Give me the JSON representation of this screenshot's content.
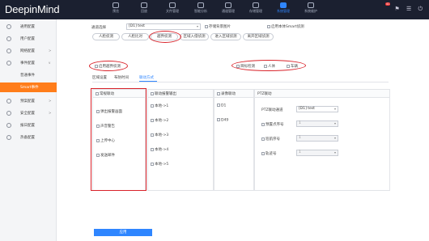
{
  "app": {
    "logo": "DeepinMind"
  },
  "topnav": [
    {
      "label": "预览",
      "icon": "preview-icon"
    },
    {
      "label": "回放",
      "icon": "playback-icon"
    },
    {
      "label": "文件管理",
      "icon": "file-icon"
    },
    {
      "label": "智能分析",
      "icon": "analysis-icon"
    },
    {
      "label": "通道管理",
      "icon": "channel-icon"
    },
    {
      "label": "存储管理",
      "icon": "storage-icon"
    },
    {
      "label": "系统管理",
      "icon": "system-icon"
    },
    {
      "label": "系统维护",
      "icon": "maintenance-icon"
    }
  ],
  "topbar": {
    "badge": "41",
    "active_index": 6
  },
  "sidebar": {
    "items": [
      {
        "label": "通用配置",
        "icon": "settings-icon",
        "arrow": ""
      },
      {
        "label": "用户配置",
        "icon": "user-icon",
        "arrow": ""
      },
      {
        "label": "网络配置",
        "icon": "network-icon",
        "arrow": ">"
      },
      {
        "label": "事件配置",
        "icon": "event-icon",
        "arrow": "v"
      }
    ],
    "sub_items": [
      {
        "label": "普通事件"
      },
      {
        "label": "Smart事件"
      }
    ],
    "more_items": [
      {
        "label": "预案配置",
        "icon": "plan-icon",
        "arrow": ">"
      },
      {
        "label": "安全配置",
        "icon": "security-icon",
        "arrow": ">"
      },
      {
        "label": "报日配置",
        "icon": "log-icon",
        "arrow": ""
      },
      {
        "label": "热备配置",
        "icon": "hotbackup-icon",
        "arrow": ""
      }
    ]
  },
  "form": {
    "channel_label": "通道选择",
    "channel_value": "[D1] test",
    "save_image_label": "存储背景图片",
    "enable_smart_label": "启用本体Smart侦测"
  },
  "tabs": [
    "人脸侦测",
    "人脸比对",
    "越界侦测",
    "区域入侵侦测",
    "进入区域侦测",
    "离开区域侦测"
  ],
  "enable_row": {
    "enable_label": "启用越界侦测",
    "target_label": "目标检测",
    "human_label": "人体",
    "vehicle_label": "车辆"
  },
  "subtabs": [
    "区域设置",
    "布防时间",
    "联动方式"
  ],
  "panels": {
    "regular": {
      "title": "常规联动",
      "items": [
        "弹出报警画面",
        "声音警告",
        "上传中心",
        "发送邮件"
      ]
    },
    "alarm_out": {
      "title": "联动报警输出",
      "items": [
        "本地->1",
        "本地->2",
        "本地->3",
        "本地->4",
        "本地->5"
      ]
    },
    "record": {
      "title": "录像联动",
      "items": [
        "D1",
        "D49"
      ]
    },
    "ptz": {
      "title": "PTZ联动",
      "channel_label": "PTZ联动通道",
      "channel_value": "[D1] test",
      "preset_label": "预置点序号",
      "preset_value": "1",
      "cruise_label": "巡航序号",
      "cruise_value": "1",
      "track_label": "轨迹号",
      "track_value": "1"
    }
  },
  "apply_label": "应用"
}
